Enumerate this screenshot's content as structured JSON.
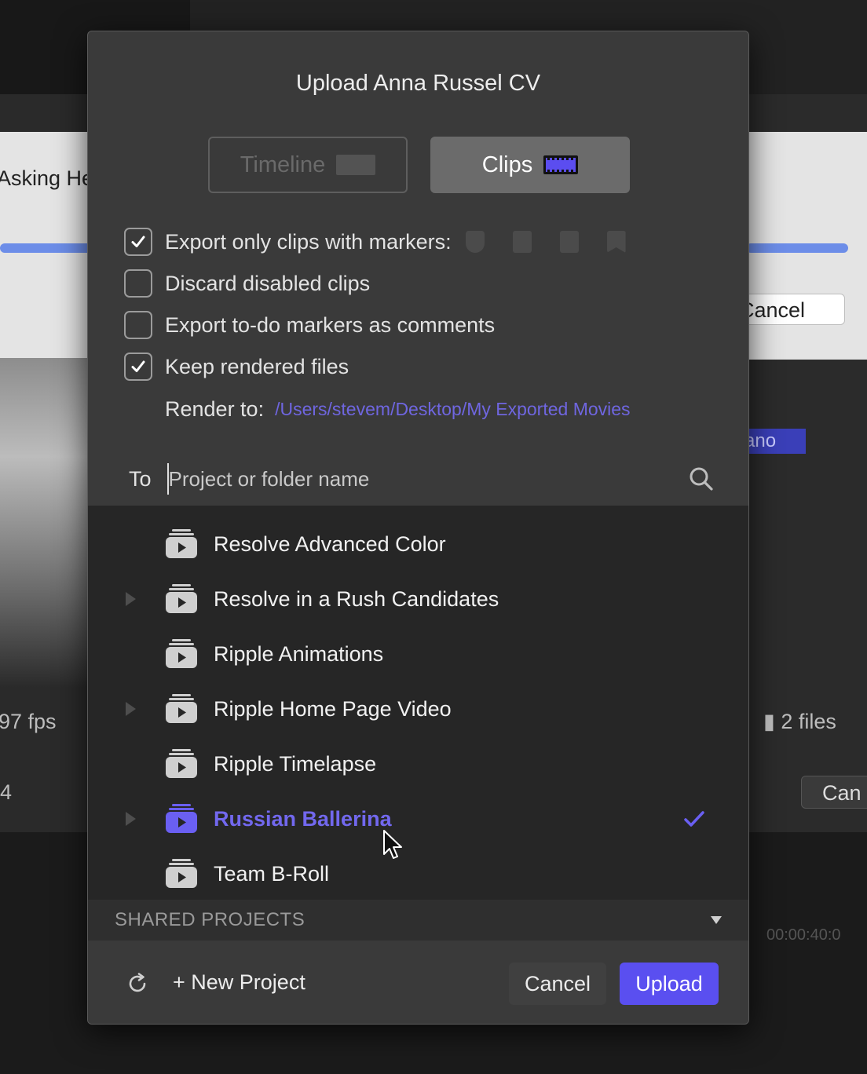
{
  "background": {
    "left_text": "Asking He",
    "right_cancel": "Cancel",
    "tag_text": "ano",
    "fps_text": "97 fps",
    "files_text": "2 files",
    "left_num": "4",
    "right_btn": "Can",
    "timecode": "00:00:40:0"
  },
  "dialog": {
    "title": "Upload Anna Russel CV",
    "tabs": [
      {
        "label": "Timeline",
        "selected": false
      },
      {
        "label": "Clips",
        "selected": true
      }
    ],
    "options": [
      {
        "label": "Export only clips with markers:",
        "checked": true
      },
      {
        "label": "Discard disabled clips",
        "checked": false
      },
      {
        "label": "Export to-do markers as comments",
        "checked": false
      },
      {
        "label": "Keep rendered files",
        "checked": true
      }
    ],
    "render_label": "Render to:",
    "render_path": "/Users/stevem/Desktop/My Exported Movies",
    "to_label": "To",
    "to_placeholder": "Project or folder name",
    "projects": [
      {
        "name": "Resolve Advanced Color",
        "has_children": false,
        "selected": false
      },
      {
        "name": "Resolve in a Rush Candidates",
        "has_children": true,
        "selected": false
      },
      {
        "name": "Ripple Animations",
        "has_children": false,
        "selected": false
      },
      {
        "name": "Ripple Home Page Video",
        "has_children": true,
        "selected": false
      },
      {
        "name": "Ripple Timelapse",
        "has_children": false,
        "selected": false
      },
      {
        "name": "Russian Ballerina",
        "has_children": true,
        "selected": true
      },
      {
        "name": "Team B-Roll",
        "has_children": false,
        "selected": false
      }
    ],
    "shared_section": "SHARED PROJECTS",
    "new_project": "+ New Project",
    "cancel": "Cancel",
    "upload": "Upload"
  },
  "colors": {
    "accent": "#5a4ff0",
    "selected_text": "#7268ee",
    "path_link": "#6f66e0"
  },
  "icons": [
    "timeline-icon",
    "clips-icon",
    "checkbox-check-icon",
    "search-icon",
    "project-icon",
    "disclosure-triangle-icon",
    "checkmark-icon",
    "chevron-down-icon",
    "refresh-icon",
    "mouse-cursor-icon"
  ]
}
